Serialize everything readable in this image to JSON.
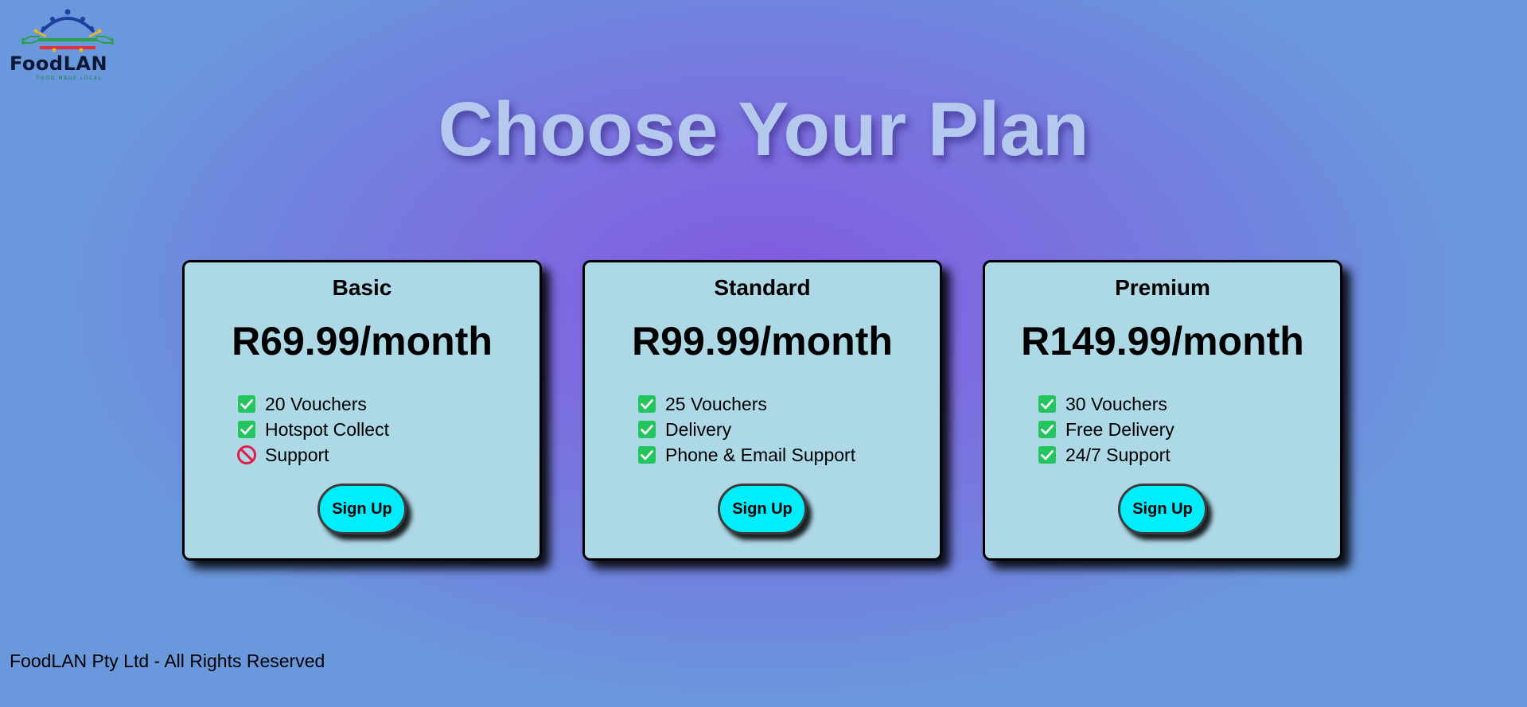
{
  "brand": {
    "name": "FoodLAN",
    "tagline": "FOOD.MADE LOCAL"
  },
  "page": {
    "title": "Choose Your Plan"
  },
  "plans": [
    {
      "name": "Basic",
      "price": "R69.99/month",
      "features": [
        {
          "text": "20 Vouchers",
          "included": true,
          "icon": "check-icon"
        },
        {
          "text": "Hotspot Collect",
          "included": true,
          "icon": "check-icon"
        },
        {
          "text": "Support",
          "included": false,
          "icon": "prohibited-icon"
        }
      ],
      "button_label": "Sign Up"
    },
    {
      "name": "Standard",
      "price": "R99.99/month",
      "features": [
        {
          "text": "25 Vouchers",
          "included": true,
          "icon": "check-icon"
        },
        {
          "text": "Delivery",
          "included": true,
          "icon": "check-icon"
        },
        {
          "text": "Phone & Email Support",
          "included": true,
          "icon": "check-icon"
        }
      ],
      "button_label": "Sign Up"
    },
    {
      "name": "Premium",
      "price": "R149.99/month",
      "features": [
        {
          "text": "30 Vouchers",
          "included": true,
          "icon": "check-icon"
        },
        {
          "text": "Free Delivery",
          "included": true,
          "icon": "check-icon"
        },
        {
          "text": "24/7 Support",
          "included": true,
          "icon": "check-icon"
        }
      ],
      "button_label": "Sign Up"
    }
  ],
  "footer": {
    "text": "FoodLAN Pty Ltd - All Rights Reserved"
  },
  "colors": {
    "card_background": "#add8e6",
    "button_background": "#00eefb",
    "check_green": "#22c55e",
    "prohibited_red": "#e11d48",
    "title_color": "#b5c8ee"
  }
}
